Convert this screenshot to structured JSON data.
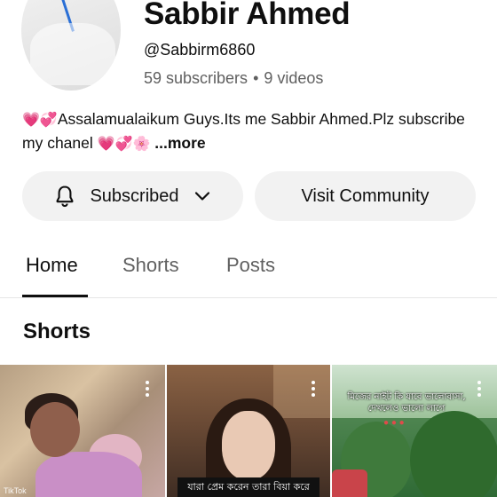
{
  "channel": {
    "name": "Sabbir Ahmed",
    "handle": "@Sabbirm6860",
    "subscribers": "59 subscribers",
    "dot": "•",
    "videos": "9 videos"
  },
  "description": {
    "emoji_lead": "💗💞",
    "text": "Assalamualaikum Guys.Its me Sabbir Ahmed.Plz subscribe my chanel ",
    "emoji_tail": "💗💞🌸",
    "more": "...more"
  },
  "buttons": {
    "subscribed_label": "Subscribed",
    "community_label": "Visit Community"
  },
  "tabs": [
    {
      "label": "Home",
      "active": true
    },
    {
      "label": "Shorts",
      "active": false
    },
    {
      "label": "Posts",
      "active": false
    }
  ],
  "section": {
    "title": "Shorts"
  },
  "shorts": [
    {
      "caption": "",
      "tag": "TikTok"
    },
    {
      "caption": "যারা প্রেম করেন তারা বিয়া করে"
    },
    {
      "caption": "মিজের নাইট কি যাবে ভালোবাসা, দেখলেও ভালো লাগে"
    }
  ],
  "icons": {
    "bell": "bell-icon",
    "chevron": "chevron-down-icon",
    "more": "more-vert-icon"
  }
}
